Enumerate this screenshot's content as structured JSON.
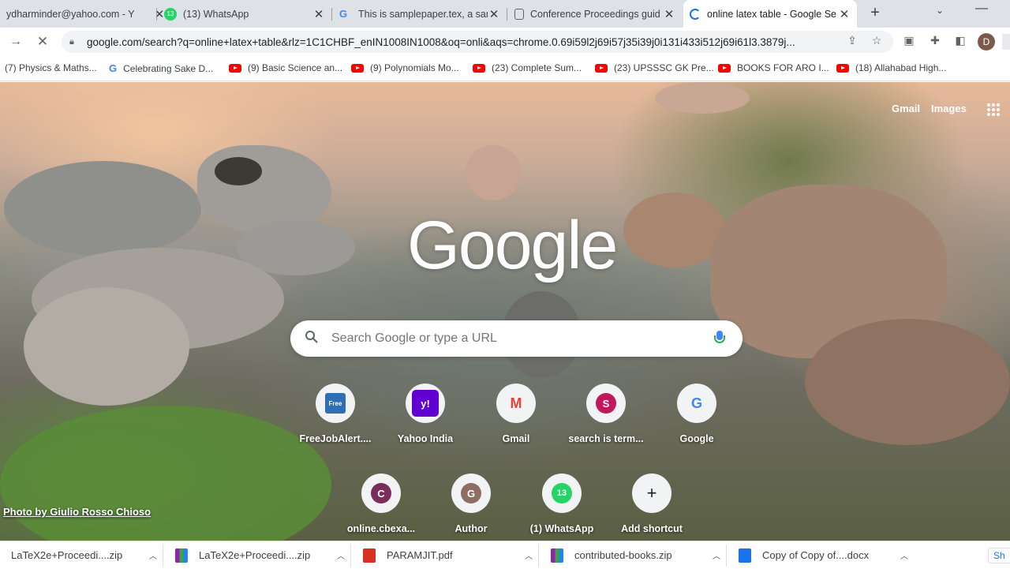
{
  "tabs": [
    {
      "title": "ydharminder@yahoo.com - Y",
      "favicon": "yahoo-mail-icon",
      "active": false
    },
    {
      "title": "(13) WhatsApp",
      "favicon": "whatsapp-icon",
      "badge": "13",
      "active": false
    },
    {
      "title": "This is samplepaper.tex, a sam",
      "favicon": "google-icon",
      "active": false
    },
    {
      "title": "Conference Proceedings guid",
      "favicon": "document-icon",
      "active": false
    },
    {
      "title": "online latex table - Google Se",
      "favicon": "loading-spinner-icon",
      "active": true
    }
  ],
  "toolbar": {
    "url": "google.com/search?q=online+latex+table&rlz=1C1CHBF_enIN1008IN1008&oq=onli&aqs=chrome.0.69i59l2j69i57j35i39j0i131i433i512j69i61l3.3879j...",
    "profile_initial": "D"
  },
  "bookmarks": [
    {
      "label": "(7) Physics & Maths...",
      "icon": "none"
    },
    {
      "label": "Celebrating Sake D...",
      "icon": "google-icon"
    },
    {
      "label": "(9) Basic Science an...",
      "icon": "youtube-icon"
    },
    {
      "label": "(9) Polynomials Mo...",
      "icon": "youtube-icon"
    },
    {
      "label": "(23) Complete Sum...",
      "icon": "youtube-icon"
    },
    {
      "label": "(23) UPSSSC GK Pre...",
      "icon": "youtube-icon"
    },
    {
      "label": "BOOKS FOR ARO I...",
      "icon": "youtube-icon"
    },
    {
      "label": "(18) Allahabad High...",
      "icon": "youtube-icon"
    }
  ],
  "ntp": {
    "gmail_link": "Gmail",
    "images_link": "Images",
    "logo_text": "Google",
    "search_placeholder": "Search Google or type a URL",
    "photo_credit": "Photo by Giulio Rosso Chioso"
  },
  "shortcuts": [
    {
      "label": "FreeJobAlert....",
      "icon": "freejobalert-icon",
      "letter": "Free",
      "color": "#2f6db5"
    },
    {
      "label": "Yahoo India",
      "icon": "yahoo-icon",
      "letter": "y!",
      "color": "#6001d2"
    },
    {
      "label": "Gmail",
      "icon": "gmail-icon",
      "letter": "M",
      "color": "#ea4335"
    },
    {
      "label": "search is term...",
      "icon": "letter-s-icon",
      "letter": "S",
      "color": "#c2185b"
    },
    {
      "label": "Google",
      "icon": "google-icon",
      "letter": "G",
      "color": "#4285f4"
    },
    {
      "label": "online.cbexa...",
      "icon": "letter-c-icon",
      "letter": "C",
      "color": "#7b2d5b"
    },
    {
      "label": "Author",
      "icon": "letter-g-icon",
      "letter": "G",
      "color": "#8d6e63"
    },
    {
      "label": "(1) WhatsApp",
      "icon": "whatsapp-icon",
      "letter": "13",
      "color": "#25d366"
    },
    {
      "label": "Add shortcut",
      "icon": "plus-icon",
      "letter": "+",
      "color": "#202124"
    }
  ],
  "downloads": [
    {
      "name": "LaTeX2e+Proceedi....zip",
      "icon": "zip-icon",
      "color": "#8e24aa"
    },
    {
      "name": "LaTeX2e+Proceedi....zip",
      "icon": "zip-icon",
      "color": "#8e24aa"
    },
    {
      "name": "PARAMJIT.pdf",
      "icon": "pdf-icon",
      "color": "#d93025"
    },
    {
      "name": "contributed-books.zip",
      "icon": "zip-icon",
      "color": "#8e24aa"
    },
    {
      "name": "Copy of Copy of....docx",
      "icon": "docx-icon",
      "color": "#1a73e8"
    }
  ],
  "downloads_show_all": "Sh"
}
